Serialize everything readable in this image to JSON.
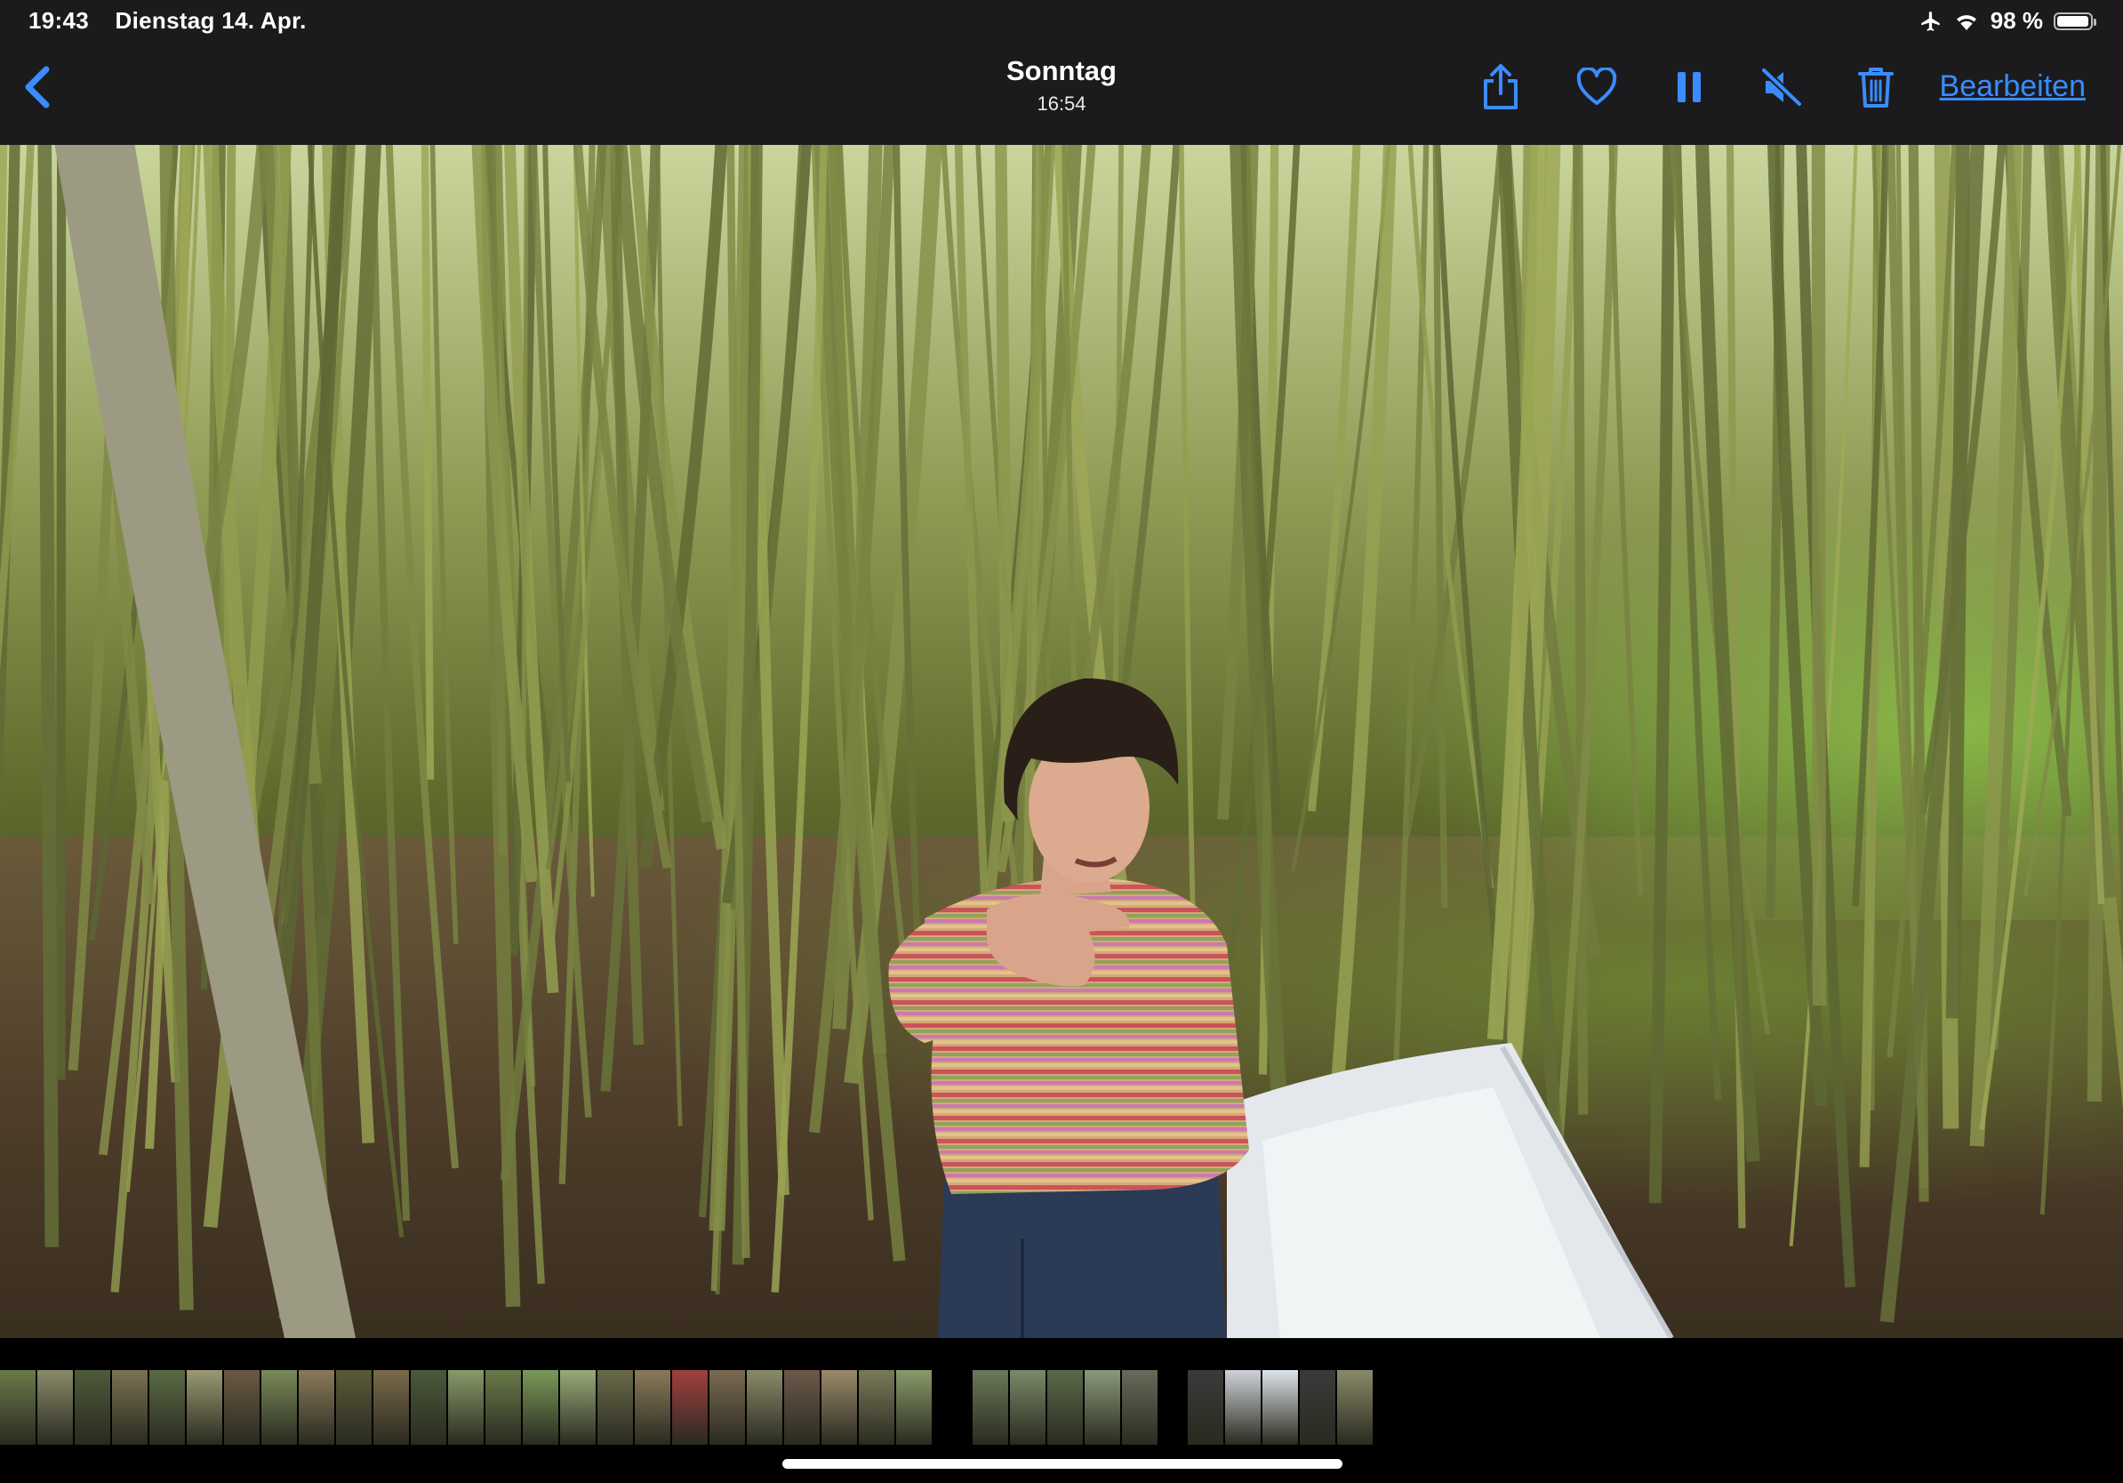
{
  "status_bar": {
    "time": "19:43",
    "date": "Dienstag 14. Apr.",
    "battery": "98 %",
    "battery_level": 0.98,
    "icons": [
      "airplane-icon",
      "wifi-icon",
      "battery-icon"
    ]
  },
  "nav": {
    "title": "Sonntag",
    "subtitle": "16:54",
    "edit_label": "Bearbeiten",
    "accent": "#3a8cff",
    "icons": [
      "back-chevron-icon",
      "share-icon",
      "heart-icon",
      "pause-icon",
      "mute-icon",
      "trash-icon"
    ]
  },
  "photo": {
    "description_colors": {
      "foliage": "#8f9a54",
      "sweater_stripes": [
        "#c9545a",
        "#d9b47a",
        "#8fa35a",
        "#c97ab0"
      ],
      "jeans": "#2b3a55",
      "tarp": "#e9ecef"
    }
  },
  "filmstrip": {
    "thumb_colors": [
      "#6b7a4a",
      "#8a8a6a",
      "#4e5a3a",
      "#7a7252",
      "#5a6a44",
      "#9a9a72",
      "#6a5a44",
      "#7a8a5a",
      "#8a7a5a",
      "#5a5a3a",
      "#7a6a4a",
      "#4a5a3a",
      "#8a9a6a",
      "#6a7a4a",
      "#7a9a5a",
      "#9aaa7a",
      "#6a6a4a",
      "#8a7a5a",
      "#a04040",
      "#7a6a52",
      "#8a8a6a",
      "#6a5a4a",
      "#9a8a6a",
      "#7a7a5a",
      "#8a9a6a",
      "#6a7a5a",
      "#7a8a6a",
      "#5a6a4a",
      "#8a9a7a",
      "#6a6a5a",
      "#3a3a3a",
      "#cfd3d8",
      "#dde3ea",
      "#3a3a3a",
      "#8a8a6a"
    ]
  }
}
